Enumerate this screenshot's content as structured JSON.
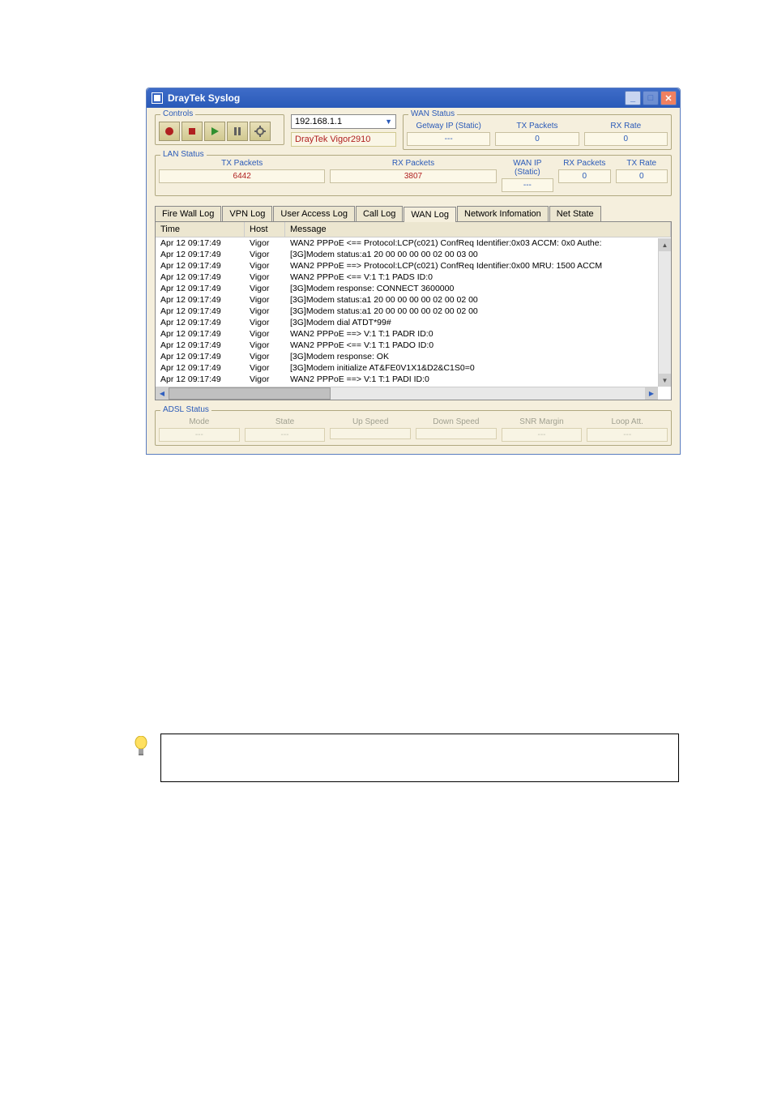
{
  "window": {
    "title": "DrayTek Syslog"
  },
  "controls": {
    "legend": "Controls"
  },
  "ip_input": "192.168.1.1",
  "device_name": "DrayTek Vigor2910",
  "wan_status": {
    "legend": "WAN Status",
    "row1": [
      {
        "label": "Getway IP (Static)",
        "val": "---"
      },
      {
        "label": "TX Packets",
        "val": "0"
      },
      {
        "label": "RX Rate",
        "val": "0"
      }
    ],
    "row2": [
      {
        "label": "WAN IP (Static)",
        "val": "---"
      },
      {
        "label": "RX Packets",
        "val": "0"
      },
      {
        "label": "TX Rate",
        "val": "0"
      }
    ]
  },
  "lan_status": {
    "legend": "LAN Status",
    "cells": [
      {
        "label": "TX Packets",
        "val": "6442"
      },
      {
        "label": "RX Packets",
        "val": "3807"
      }
    ]
  },
  "tabs": {
    "items": [
      "Fire Wall Log",
      "VPN Log",
      "User Access Log",
      "Call Log",
      "WAN Log",
      "Network Infomation",
      "Net State"
    ],
    "active": "WAN Log"
  },
  "log_headers": {
    "time": "Time",
    "host": "Host",
    "msg": "Message"
  },
  "log_rows": [
    {
      "t": "Apr 12 09:17:49",
      "h": "Vigor",
      "m": "WAN2 PPPoE <== Protocol:LCP(c021) ConfReq Identifier:0x03 ACCM: 0x0 Authe:"
    },
    {
      "t": "Apr 12 09:17:49",
      "h": "Vigor",
      "m": "[3G]Modem status:a1 20 00 00 00 00 02 00 03 00"
    },
    {
      "t": "Apr 12 09:17:49",
      "h": "Vigor",
      "m": "WAN2 PPPoE ==> Protocol:LCP(c021) ConfReq Identifier:0x00 MRU: 1500 ACCM"
    },
    {
      "t": "Apr 12 09:17:49",
      "h": "Vigor",
      "m": "WAN2 PPPoE <== V:1 T:1 PADS ID:0"
    },
    {
      "t": "Apr 12 09:17:49",
      "h": "Vigor",
      "m": "[3G]Modem response: CONNECT 3600000"
    },
    {
      "t": "Apr 12 09:17:49",
      "h": "Vigor",
      "m": "[3G]Modem status:a1 20 00 00 00 00 02 00 02 00"
    },
    {
      "t": "Apr 12 09:17:49",
      "h": "Vigor",
      "m": "[3G]Modem status:a1 20 00 00 00 00 02 00 02 00"
    },
    {
      "t": "Apr 12 09:17:49",
      "h": "Vigor",
      "m": "[3G]Modem dial ATDT*99#"
    },
    {
      "t": "Apr 12 09:17:49",
      "h": "Vigor",
      "m": "WAN2 PPPoE ==> V:1 T:1 PADR ID:0"
    },
    {
      "t": "Apr 12 09:17:49",
      "h": "Vigor",
      "m": "WAN2 PPPoE <== V:1 T:1 PADO ID:0"
    },
    {
      "t": "Apr 12 09:17:49",
      "h": "Vigor",
      "m": "[3G]Modem response: OK"
    },
    {
      "t": "Apr 12 09:17:49",
      "h": "Vigor",
      "m": "[3G]Modem initialize AT&FE0V1X1&D2&C1S0=0"
    },
    {
      "t": "Apr 12 09:17:49",
      "h": "Vigor",
      "m": "WAN2 PPPoE ==> V:1 T:1 PADI ID:0"
    }
  ],
  "adsl_status": {
    "legend": "ADSL Status",
    "cells": [
      {
        "label": "Mode",
        "val": "---"
      },
      {
        "label": "State",
        "val": "---"
      },
      {
        "label": "Up Speed",
        "val": ""
      },
      {
        "label": "Down Speed",
        "val": ""
      },
      {
        "label": "SNR Margin",
        "val": "---"
      },
      {
        "label": "Loop Att.",
        "val": "---"
      }
    ]
  }
}
